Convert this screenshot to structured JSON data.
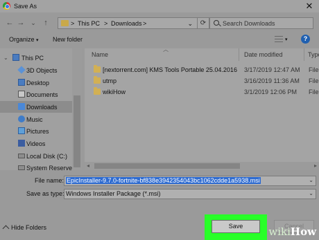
{
  "window": {
    "title": "Save As",
    "close_glyph": "✕"
  },
  "nav": {
    "back_glyph": "←",
    "forward_glyph": "→",
    "up_list_glyph": "⌄",
    "up_glyph": "↑",
    "breadcrumb": [
      "This PC",
      "Downloads"
    ],
    "sep": ">",
    "refresh_glyph": "⟳",
    "search_placeholder": "Search Downloads"
  },
  "toolbar": {
    "organize": "Organize",
    "organize_caret": "▾",
    "new_folder": "New folder",
    "view_caret": "▾",
    "help": "?"
  },
  "tree": [
    {
      "label": "This PC",
      "icon": "pc-icon",
      "arrow": "⌄"
    },
    {
      "label": "3D Objects",
      "icon": "cube-icon"
    },
    {
      "label": "Desktop",
      "icon": "desktop-icon"
    },
    {
      "label": "Documents",
      "icon": "documents-icon"
    },
    {
      "label": "Downloads",
      "icon": "downloads-icon",
      "selected": true
    },
    {
      "label": "Music",
      "icon": "music-icon"
    },
    {
      "label": "Pictures",
      "icon": "pictures-icon"
    },
    {
      "label": "Videos",
      "icon": "videos-icon"
    },
    {
      "label": "Local Disk (C:)",
      "icon": "disk-icon"
    },
    {
      "label": "System Reserved",
      "icon": "disk-icon"
    }
  ],
  "files": {
    "columns": {
      "name": "Name",
      "date": "Date modified",
      "type": "Type"
    },
    "rows": [
      {
        "name": "[nextorrent.com] KMS Tools Portable 25.04.2016",
        "date": "3/17/2019 12:47 AM",
        "type": "File"
      },
      {
        "name": "utmp",
        "date": "3/16/2019 11:36 AM",
        "type": "File"
      },
      {
        "name": "wikiHow",
        "date": "3/1/2019 12:06 PM",
        "type": "File"
      }
    ]
  },
  "form": {
    "file_name_label": "File name:",
    "file_name_value": "EpicInstaller-9.7.0-fortnite-bf838e3942354043bc1062cdde1a5938.msi",
    "save_type_label": "Save as type:",
    "save_type_value": "Windows Installer Package (*.msi)"
  },
  "footer": {
    "hide_folders": "Hide Folders",
    "save": "Save",
    "cancel": "Cancel"
  },
  "watermark": {
    "wiki": "wiki",
    "how": "How"
  },
  "colors": {
    "highlight_box": "#28ff28",
    "selection": "#2e6bd0"
  }
}
